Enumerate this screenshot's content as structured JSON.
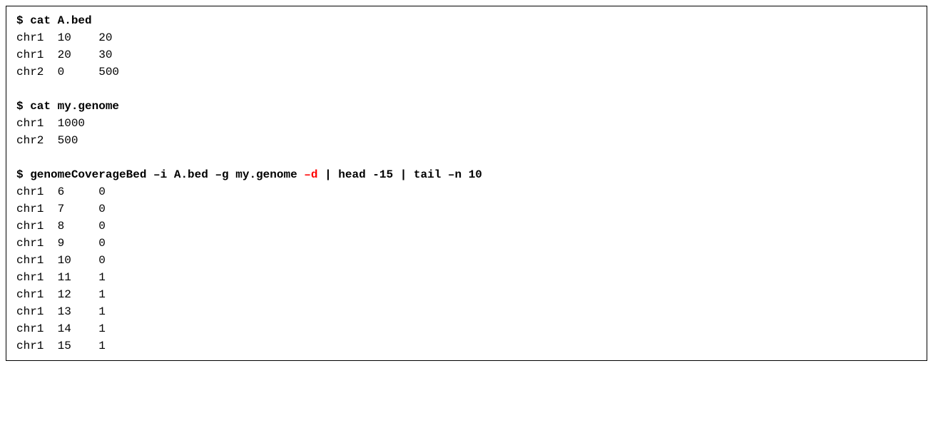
{
  "prompt1": "$ cat A.bed",
  "abed": [
    "chr1  10    20",
    "chr1  20    30",
    "chr2  0     500"
  ],
  "blank": "",
  "prompt2": "$ cat my.genome",
  "mygenome": [
    "chr1  1000",
    "chr2  500"
  ],
  "prompt3_pre": "$ genomeCoverageBed –i A.bed –g my.genome ",
  "prompt3_flag": "–d",
  "prompt3_post": " | head -15 | tail –n 10",
  "output": [
    "chr1  6     0",
    "chr1  7     0",
    "chr1  8     0",
    "chr1  9     0",
    "chr1  10    0",
    "chr1  11    1",
    "chr1  12    1",
    "chr1  13    1",
    "chr1  14    1",
    "chr1  15    1"
  ]
}
